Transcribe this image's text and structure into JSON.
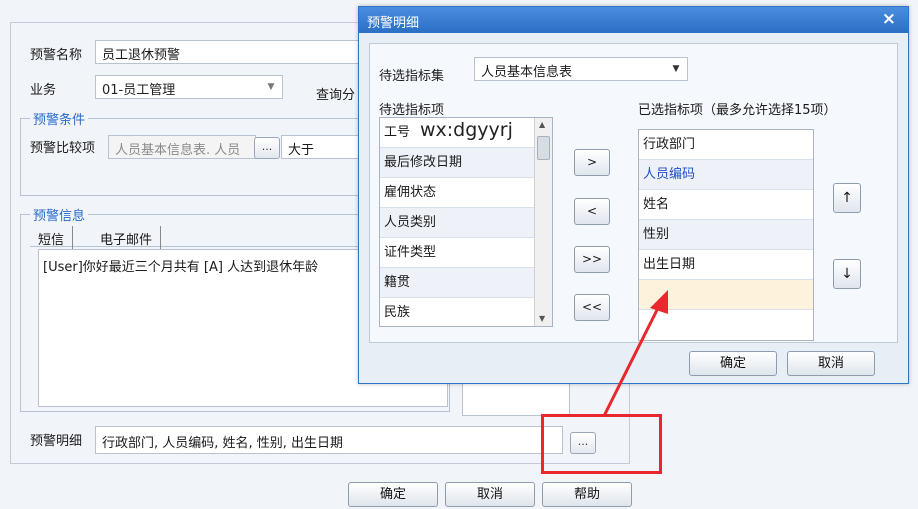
{
  "main": {
    "warning_name_label": "预警名称",
    "warning_name_value": "员工退休预警",
    "business_label": "业务",
    "business_value": "01-员工管理",
    "query_label": "查询分",
    "condition_legend": "预警条件",
    "compare_label": "预警比较项",
    "compare_value": "人员基本信息表. 人员",
    "compare_dots": "...",
    "compare_operator": "大于",
    "info_legend": "预警信息",
    "tabs": [
      "短信",
      "电子邮件"
    ],
    "message_text": "[User]你好最近三个月共有 [A] 人达到退休年龄",
    "detail_label": "预警明细",
    "detail_value": "行政部门, 人员编码, 姓名, 性别, 出生日期",
    "detail_dots": "...",
    "buttons": {
      "ok": "确定",
      "cancel": "取消",
      "help": "帮助"
    }
  },
  "dialog": {
    "title": "预警明细",
    "close": "×",
    "indicator_set_label": "待选指标集",
    "indicator_set_value": "人员基本信息表",
    "available_label": "待选指标项",
    "available_items": [
      "工号",
      "最后修改日期",
      "雇佣状态",
      "人员类别",
      "证件类型",
      "籍贯",
      "民族"
    ],
    "watermark": "wx:dgyyrj",
    "selected_label": "已选指标项（最多允许选择15项）",
    "selected_items": [
      "行政部门",
      "人员编码",
      "姓名",
      "性别",
      "出生日期",
      ""
    ],
    "move_buttons": {
      "add": ">",
      "remove": "<",
      "add_all": ">>",
      "remove_all": "<<"
    },
    "order_buttons": {
      "up": "↑",
      "down": "↓"
    },
    "ok": "确定",
    "cancel": "取消",
    "colors": {
      "selected_link": "#1f4fc8",
      "pending_row": "#fdf3dc",
      "titlebar": "#2f74c8"
    }
  },
  "annotation": {
    "color": "#e8282c"
  }
}
